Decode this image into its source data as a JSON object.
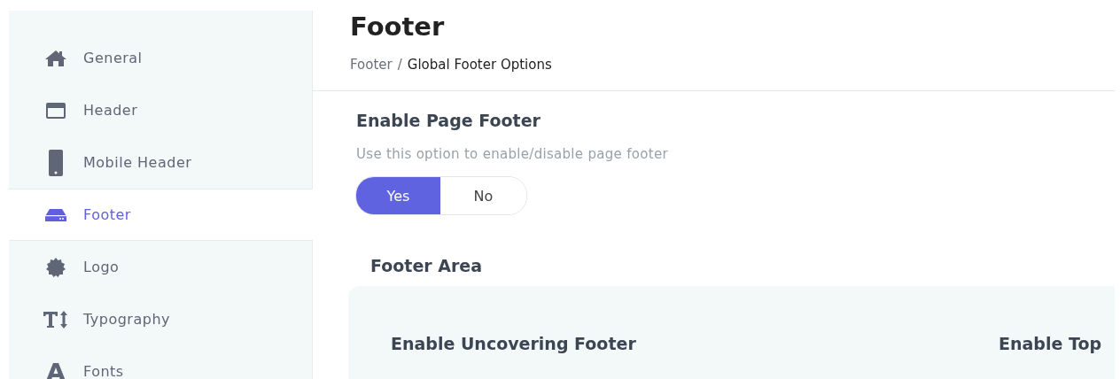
{
  "sidebar": {
    "items": [
      {
        "label": "General",
        "selected": false
      },
      {
        "label": "Header",
        "selected": false
      },
      {
        "label": "Mobile Header",
        "selected": false
      },
      {
        "label": "Footer",
        "selected": true
      },
      {
        "label": "Logo",
        "selected": false
      },
      {
        "label": "Typography",
        "selected": false
      },
      {
        "label": "Fonts",
        "selected": false
      }
    ]
  },
  "page": {
    "title": "Footer",
    "breadcrumb": {
      "parent": "Footer",
      "separator": "/",
      "current": "Global Footer Options"
    }
  },
  "setting": {
    "title": "Enable Page Footer",
    "description": "Use this option to enable/disable page footer",
    "options": [
      {
        "label": "Yes",
        "selected": true
      },
      {
        "label": "No",
        "selected": false
      }
    ]
  },
  "section": {
    "title": "Footer Area",
    "fields": [
      "Enable Uncovering Footer",
      "Enable Top"
    ]
  }
}
